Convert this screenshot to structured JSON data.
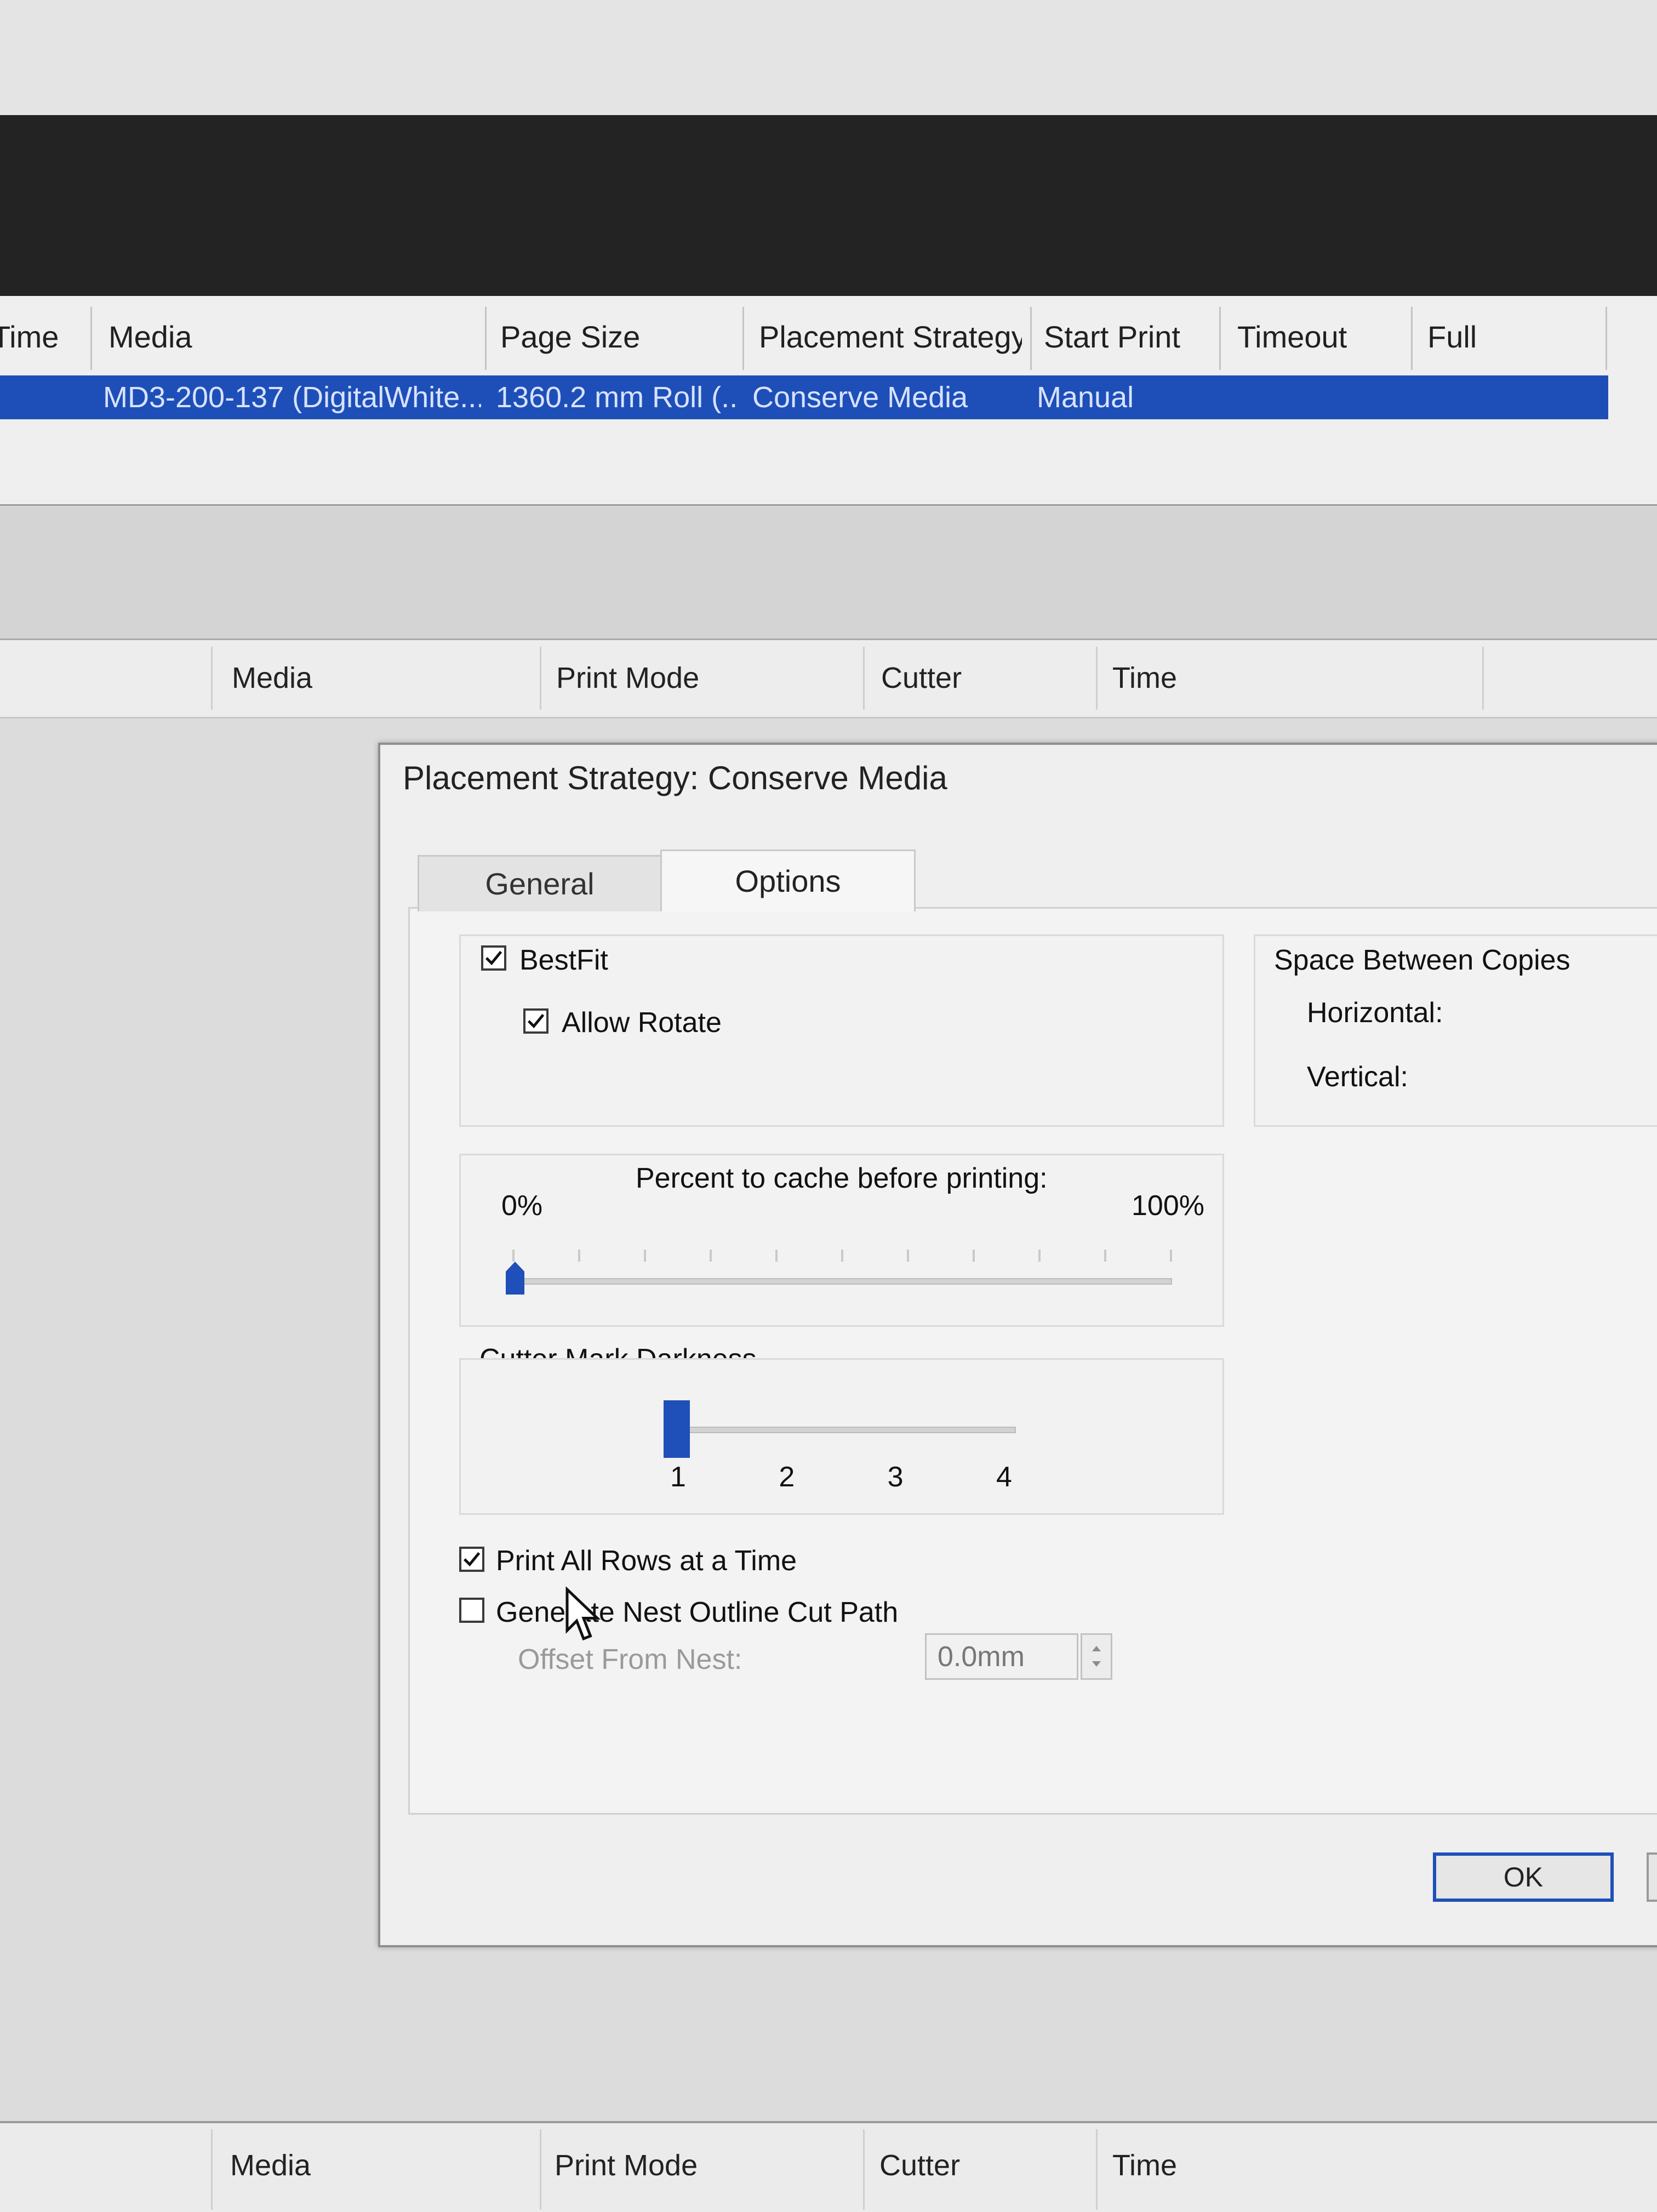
{
  "queue": {
    "columns": [
      "Time",
      "Media",
      "Page Size",
      "Placement Strategy",
      "Start Print",
      "Timeout",
      "Full"
    ],
    "row": {
      "media": "MD3-200-137 (DigitalWhite...",
      "page_size": "1360.2 mm Roll (...",
      "placement_strategy": "Conserve Media",
      "start_print": "Manual"
    }
  },
  "job_table": {
    "columns": [
      "Media",
      "Print Mode",
      "Cutter",
      "Time"
    ]
  },
  "dialog": {
    "title": "Placement Strategy: Conserve Media",
    "tabs": [
      {
        "label": "General",
        "active": false
      },
      {
        "label": "Options",
        "active": true
      }
    ],
    "bestfit": {
      "label": "BestFit",
      "checked": true
    },
    "allow_rotate": {
      "label": "Allow Rotate",
      "checked": true
    },
    "space_between": {
      "title": "Space Between Copies",
      "horizontal_label": "Horizontal:",
      "vertical_label": "Vertical:"
    },
    "cache": {
      "title": "Percent to cache before printing:",
      "min_label": "0%",
      "max_label": "100%",
      "value_percent": 0
    },
    "cutter_mark": {
      "title": "Cutter Mark Darkness",
      "ticks": [
        "1",
        "2",
        "3",
        "4"
      ],
      "value": 1
    },
    "print_all_rows": {
      "label": "Print All Rows at a Time",
      "checked": true
    },
    "generate_nest": {
      "label": "Generate Nest Outline Cut Path",
      "checked": false
    },
    "offset": {
      "label": "Offset From Nest:",
      "value": "0.0mm"
    },
    "ok_label": "OK"
  },
  "bottom_table": {
    "columns": [
      "Media",
      "Print Mode",
      "Cutter",
      "Time"
    ]
  },
  "colors": {
    "selection": "#1e4fb8",
    "accent": "#1f4fb8"
  }
}
